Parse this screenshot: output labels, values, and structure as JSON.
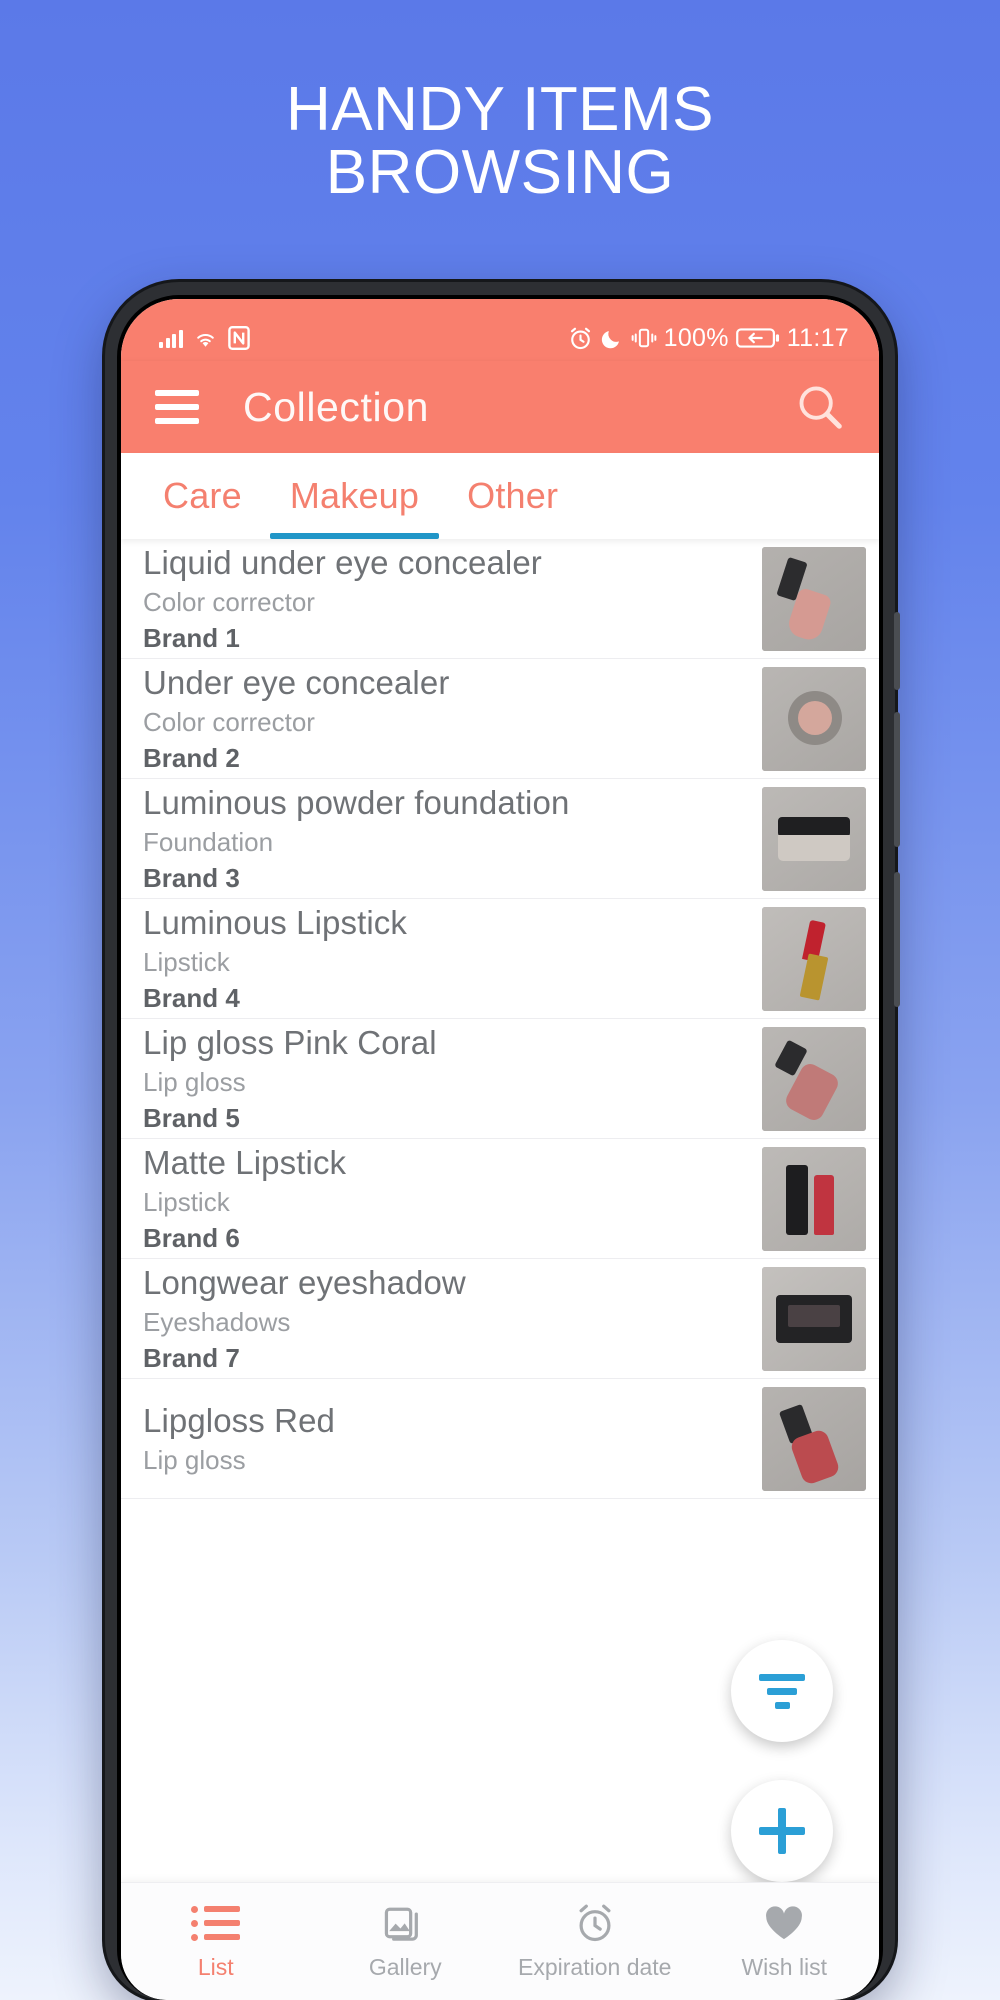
{
  "promo": {
    "line1": "HANDY ITEMS",
    "line2": "BROWSING"
  },
  "colors": {
    "background_top": "#5b79e8",
    "accent_coral": "#f97f6e",
    "tab_indicator_blue": "#2196c8",
    "fab_icon_blue": "#2b9fd6"
  },
  "statusbar": {
    "left_icons": [
      "signal-bars-icon",
      "wifi-icon",
      "nfc-icon"
    ],
    "right_icons": [
      "alarm-icon",
      "moon-icon",
      "vibrate-icon",
      "battery-charging-icon"
    ],
    "battery_percent": "100%",
    "time": "11:17"
  },
  "appbar": {
    "menu_icon": "hamburger-menu-icon",
    "title": "Collection",
    "search_icon": "search-icon"
  },
  "tabs": [
    {
      "label": "Care",
      "active": false
    },
    {
      "label": "Makeup",
      "active": true
    },
    {
      "label": "Other",
      "active": false
    }
  ],
  "items": [
    {
      "title": "Liquid under eye concealer",
      "category": "Color corrector",
      "brand": "Brand 1",
      "thumb": "concealer-tube-photo"
    },
    {
      "title": "Under eye concealer",
      "category": "Color corrector",
      "brand": "Brand 2",
      "thumb": "concealer-pot-photo"
    },
    {
      "title": "Luminous powder foundation",
      "category": "Foundation",
      "brand": "Brand 3",
      "thumb": "powder-compact-photo"
    },
    {
      "title": "Luminous Lipstick",
      "category": "Lipstick",
      "brand": "Brand 4",
      "thumb": "red-lipstick-photo"
    },
    {
      "title": "Lip gloss Pink Coral",
      "category": "Lip gloss",
      "brand": "Brand 5",
      "thumb": "pink-lipgloss-photo"
    },
    {
      "title": "Matte Lipstick",
      "category": "Lipstick",
      "brand": "Brand 6",
      "thumb": "matte-lipstick-photo"
    },
    {
      "title": "Longwear eyeshadow",
      "category": "Eyeshadows",
      "brand": "Brand 7",
      "thumb": "eyeshadow-palette-photo"
    },
    {
      "title": "Lipgloss Red",
      "category": "Lip gloss",
      "brand": "",
      "thumb": "red-lipgloss-photo"
    }
  ],
  "fabs": {
    "filter_icon": "filter-sort-icon",
    "add_icon": "plus-icon"
  },
  "bottomnav": [
    {
      "label": "List",
      "icon": "list-icon",
      "active": true
    },
    {
      "label": "Gallery",
      "icon": "gallery-images-icon",
      "active": false
    },
    {
      "label": "Expiration date",
      "icon": "alarm-clock-icon",
      "active": false
    },
    {
      "label": "Wish list",
      "icon": "heart-icon",
      "active": false
    }
  ]
}
